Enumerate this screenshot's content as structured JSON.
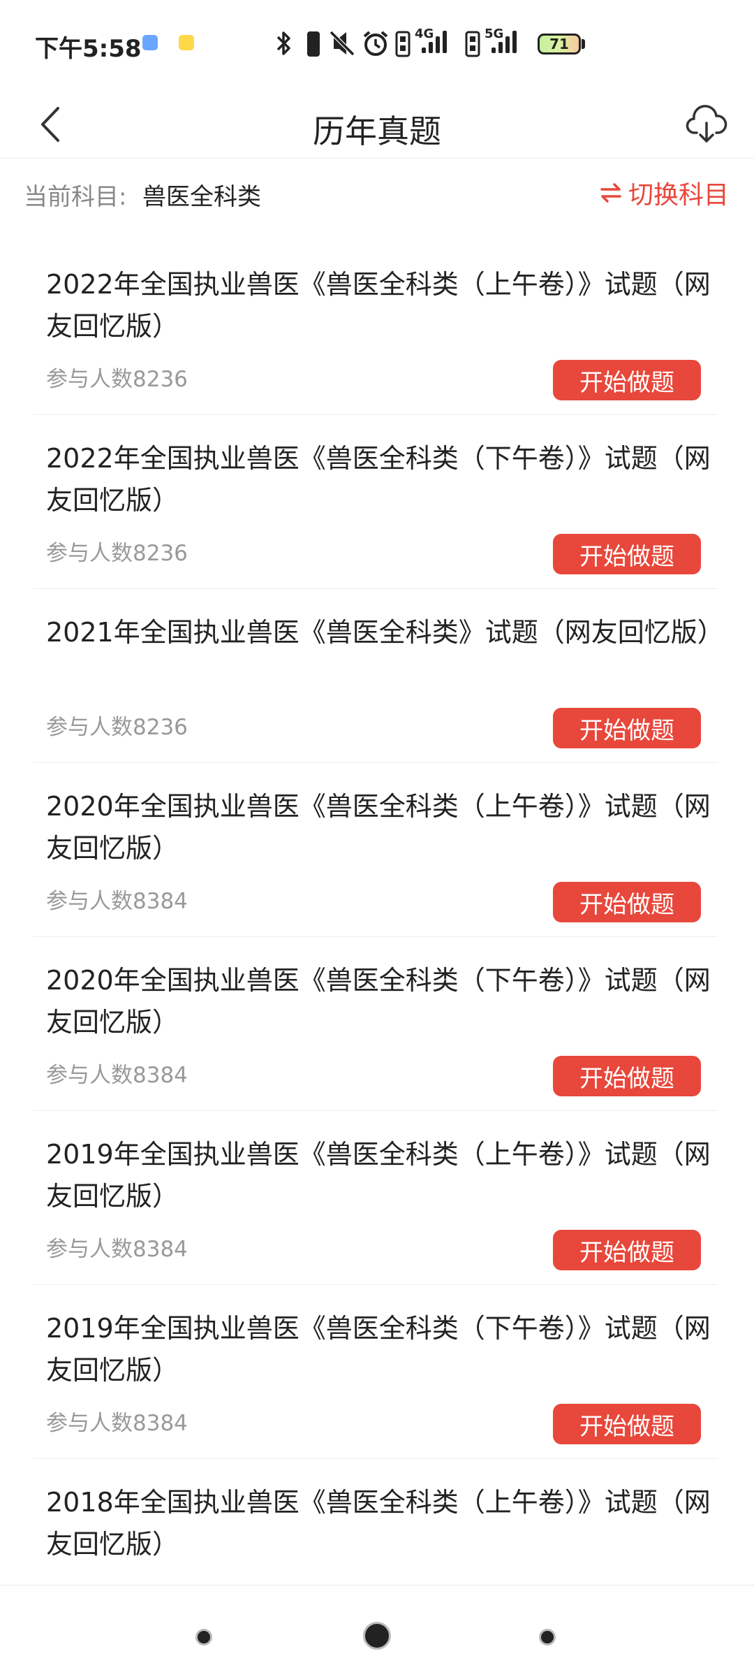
{
  "status_bar": {
    "time": "下午5:58",
    "network_1": "4G",
    "network_2": "5G",
    "battery": "71"
  },
  "header": {
    "title": "历年真题"
  },
  "subject": {
    "label": "当前科目:",
    "value": "兽医全科类",
    "switch_label": "切换科目"
  },
  "exams": [
    {
      "title": "2022年全国执业兽医《兽医全科类（上午卷）》试题（网友回忆版）",
      "count": "参与人数8236",
      "button": "开始做题"
    },
    {
      "title": "2022年全国执业兽医《兽医全科类（下午卷）》试题（网友回忆版）",
      "count": "参与人数8236",
      "button": "开始做题"
    },
    {
      "title": "2021年全国执业兽医《兽医全科类》试题（网友回忆版）",
      "count": "参与人数8236",
      "button": "开始做题"
    },
    {
      "title": "2020年全国执业兽医《兽医全科类（上午卷）》试题（网友回忆版）",
      "count": "参与人数8384",
      "button": "开始做题"
    },
    {
      "title": "2020年全国执业兽医《兽医全科类（下午卷）》试题（网友回忆版）",
      "count": "参与人数8384",
      "button": "开始做题"
    },
    {
      "title": "2019年全国执业兽医《兽医全科类（上午卷）》试题（网友回忆版）",
      "count": "参与人数8384",
      "button": "开始做题"
    },
    {
      "title": "2019年全国执业兽医《兽医全科类（下午卷）》试题（网友回忆版）",
      "count": "参与人数8384",
      "button": "开始做题"
    },
    {
      "title": "2018年全国执业兽医《兽医全科类（上午卷）》试题（网友回忆版）"
    }
  ],
  "colors": {
    "accent": "#e8473b",
    "text_primary": "#222222",
    "text_secondary": "#999999"
  }
}
